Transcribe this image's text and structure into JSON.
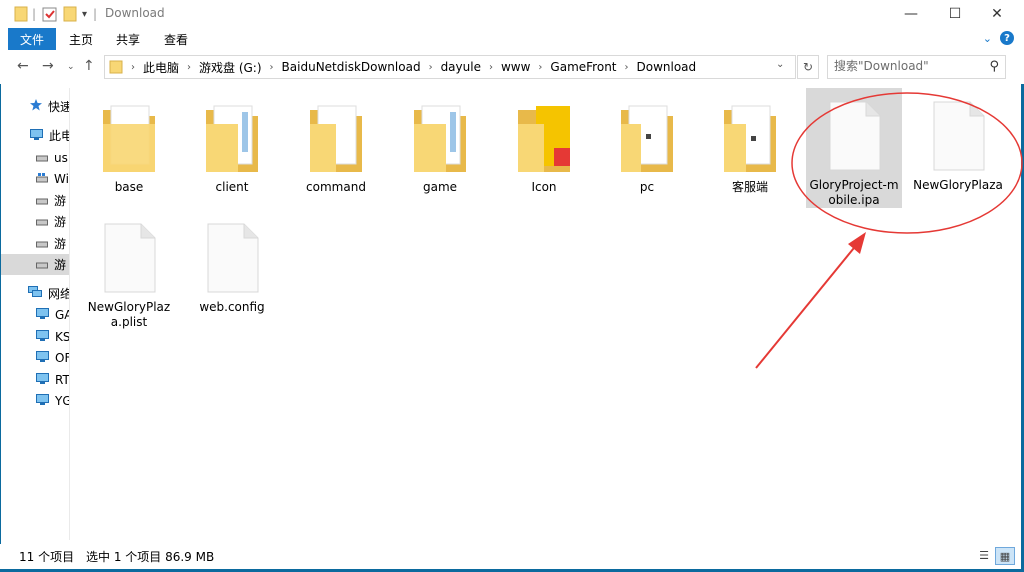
{
  "window": {
    "title": "Download",
    "controls": {
      "minimize": "—",
      "maximize": "☐",
      "close": "✕"
    }
  },
  "ribbon": {
    "file_tab": "文件",
    "tabs": [
      "主页",
      "共享",
      "查看"
    ],
    "help": "?"
  },
  "address": {
    "crumbs": [
      "此电脑",
      "游戏盘 (G:)",
      "BaiduNetdiskDownload",
      "dayule",
      "www",
      "GameFront",
      "Download"
    ]
  },
  "search": {
    "placeholder": "搜索\"Download\""
  },
  "sidebar": {
    "items": [
      {
        "label": "快速",
        "icon": "star-icon"
      },
      {
        "label": "此电",
        "icon": "computer-icon"
      },
      {
        "label": "us",
        "icon": "drive-icon"
      },
      {
        "label": "Wi",
        "icon": "windows-drive-icon"
      },
      {
        "label": "游",
        "icon": "drive-icon"
      },
      {
        "label": "游",
        "icon": "drive-icon"
      },
      {
        "label": "游",
        "icon": "drive-icon"
      },
      {
        "label": "游",
        "icon": "drive-icon"
      },
      {
        "label": "网络",
        "icon": "network-icon"
      },
      {
        "label": "GA",
        "icon": "monitor-icon"
      },
      {
        "label": "KS",
        "icon": "monitor-icon"
      },
      {
        "label": "OF",
        "icon": "monitor-icon"
      },
      {
        "label": "RT",
        "icon": "monitor-icon"
      },
      {
        "label": "YG",
        "icon": "monitor-icon"
      }
    ]
  },
  "files": [
    {
      "name": "base",
      "type": "folder-doc"
    },
    {
      "name": "client",
      "type": "folder-doc"
    },
    {
      "name": "command",
      "type": "folder-doc"
    },
    {
      "name": "game",
      "type": "folder-doc"
    },
    {
      "name": "Icon",
      "type": "folder-icon-image"
    },
    {
      "name": "pc",
      "type": "folder-doc"
    },
    {
      "name": "客服端",
      "type": "folder-doc"
    },
    {
      "name": "GloryProject-mobile.ipa",
      "type": "file",
      "selected": true
    },
    {
      "name": "NewGloryPlaza",
      "type": "file"
    },
    {
      "name": "NewGloryPlaza.plist",
      "type": "file"
    },
    {
      "name": "web.config",
      "type": "file"
    }
  ],
  "status": {
    "count": "11 个项目",
    "selection": "选中 1 个项目  86.9 MB"
  },
  "colors": {
    "accent": "#1979ca",
    "annotation": "#e53935",
    "folder": "#f8d775"
  }
}
